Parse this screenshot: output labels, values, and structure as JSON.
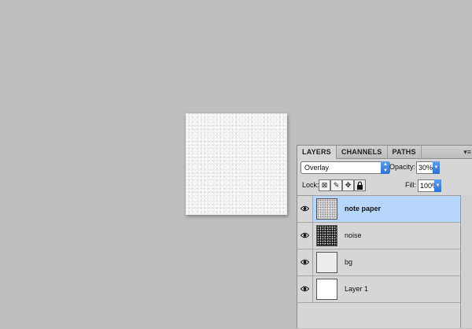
{
  "panel": {
    "tabs": [
      "LAYERS",
      "CHANNELS",
      "PATHS"
    ],
    "menu_icon": "▾≡",
    "blend_mode": "Overlay",
    "opacity_label": "Opacity:",
    "opacity_value": "30%",
    "lock_label": "Lock:",
    "fill_label": "Fill:",
    "fill_value": "100%",
    "stepper_glyph": "▲▼",
    "dropdown_glyph": "▼",
    "lock_icons": [
      "transparency-lock-icon",
      "brush-icon",
      "move-icon",
      "padlock-icon"
    ]
  },
  "layers": [
    {
      "name": "note paper",
      "selected": true,
      "thumb": "note"
    },
    {
      "name": "noise",
      "selected": false,
      "thumb": "noise"
    },
    {
      "name": "bg",
      "selected": false,
      "thumb": "bg"
    },
    {
      "name": "Layer 1",
      "selected": false,
      "thumb": "layer1"
    }
  ],
  "colors": {
    "workspace": "#bebebe",
    "selection": "#b6d6fb",
    "accent": "#2c6fd6"
  }
}
